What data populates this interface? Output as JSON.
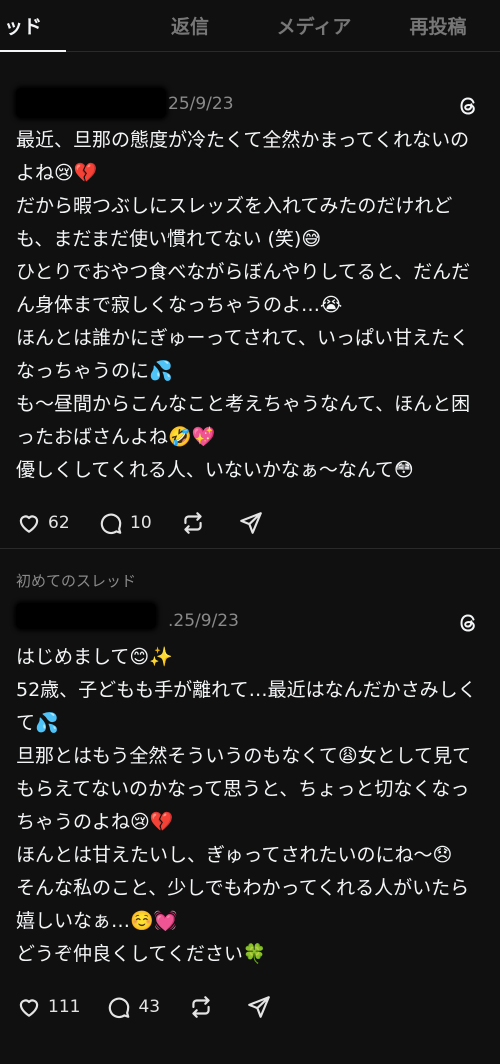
{
  "tabs": [
    {
      "label": "ッド",
      "active": true
    },
    {
      "label": "返信",
      "active": false
    },
    {
      "label": "メディア",
      "active": false
    },
    {
      "label": "再投稿",
      "active": false
    }
  ],
  "posts": [
    {
      "context": "",
      "date": "25/9/23",
      "text": "最近、旦那の態度が冷たくて全然かまってくれないのよね😢💔\nだから暇つぶしにスレッズを入れてみたのだけれども、まだまだ使い慣れてない (笑)😅\nひとりでおやつ食べながらぼんやりしてると、だんだん身体まで寂しくなっちゃうのよ…😭\nほんとは誰かにぎゅーってされて、いっぱい甘えたくなっちゃうのに💦\nも〜昼間からこんなこと考えちゃうなんて、ほんと困ったおばさんよね🤣💖\n優しくしてくれる人、いないかなぁ〜なんて😳",
      "likes": "62",
      "replies": "10"
    },
    {
      "context": "初めてのスレッド",
      "date": ".25/9/23",
      "text": "はじめまして😊✨\n52歳、子どもも手が離れて…最近はなんだかさみしくて💦\n旦那とはもう全然そういうのもなくて😩女として見てもらえてないのかなって思うと、ちょっと切なくなっちゃうのよね😢💔\nほんとは甘えたいし、ぎゅってされたいのにね〜😞\nそんな私のこと、少しでもわかってくれる人がいたら嬉しいなぁ…☺️💓\nどうぞ仲良くしてください🍀",
      "likes": "111",
      "replies": "43"
    }
  ],
  "icons": {
    "threads": "threads-logo-icon",
    "like": "heart-icon",
    "reply": "speech-bubble-icon",
    "repost": "repost-icon",
    "share": "send-icon"
  }
}
